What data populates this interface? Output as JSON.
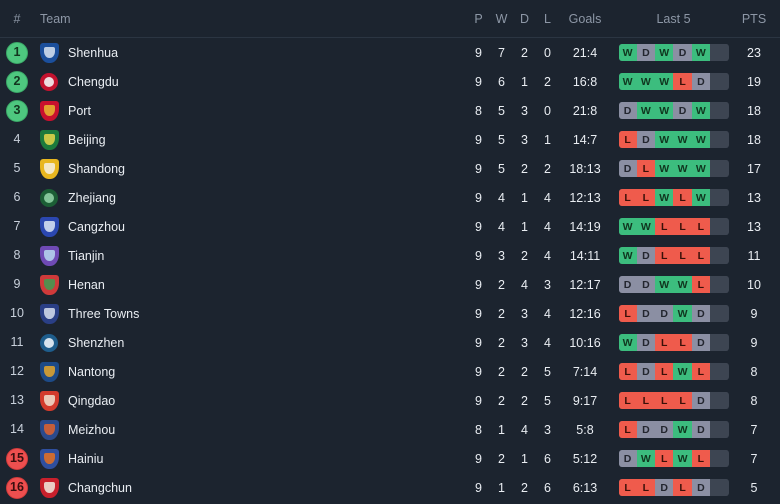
{
  "header": {
    "rank": "#",
    "team": "Team",
    "played": "P",
    "won": "W",
    "drawn": "D",
    "lost": "L",
    "goals": "Goals",
    "last5": "Last 5",
    "points": "PTS"
  },
  "colors": {
    "background": "#1c242f",
    "promotion_badge": "#4ec77f",
    "relegation_badge": "#ee4f4f",
    "win": "#3cbd7e",
    "draw": "#8b8fa3",
    "loss": "#ef5b4c",
    "empty_slot": "#3d4552",
    "text": "#e9edf2",
    "muted_text": "#8d97a6",
    "divider": "#2b3542"
  },
  "rows": [
    {
      "rank": "1",
      "team": "Shenhua",
      "p": "9",
      "w": "7",
      "d": "2",
      "l": "0",
      "goals": "21:4",
      "last5": [
        "W",
        "D",
        "W",
        "D",
        "W"
      ],
      "pts": "23",
      "zone": "promo",
      "crest": {
        "shape": "shield",
        "primary": "#1b4f9c",
        "secondary": "#d9e4f2"
      }
    },
    {
      "rank": "2",
      "team": "Chengdu",
      "p": "9",
      "w": "6",
      "d": "1",
      "l": "2",
      "goals": "16:8",
      "last5": [
        "W",
        "W",
        "W",
        "L",
        "D"
      ],
      "pts": "19",
      "zone": "promo",
      "crest": {
        "shape": "circle",
        "primary": "#c3122e",
        "secondary": "#f2f2f2"
      }
    },
    {
      "rank": "3",
      "team": "Port",
      "p": "8",
      "w": "5",
      "d": "3",
      "l": "0",
      "goals": "21:8",
      "last5": [
        "D",
        "W",
        "W",
        "D",
        "W"
      ],
      "pts": "18",
      "zone": "promo",
      "crest": {
        "shape": "shield",
        "primary": "#c8102e",
        "secondary": "#e8b92f"
      }
    },
    {
      "rank": "4",
      "team": "Beijing",
      "p": "9",
      "w": "5",
      "d": "3",
      "l": "1",
      "goals": "14:7",
      "last5": [
        "L",
        "D",
        "W",
        "W",
        "W"
      ],
      "pts": "18",
      "zone": "none",
      "crest": {
        "shape": "shield",
        "primary": "#1c7a3c",
        "secondary": "#e8d74a"
      }
    },
    {
      "rank": "5",
      "team": "Shandong",
      "p": "9",
      "w": "5",
      "d": "2",
      "l": "2",
      "goals": "18:13",
      "last5": [
        "D",
        "L",
        "W",
        "W",
        "W"
      ],
      "pts": "17",
      "zone": "none",
      "crest": {
        "shape": "shield",
        "primary": "#e8b61f",
        "secondary": "#f4f0e4"
      }
    },
    {
      "rank": "6",
      "team": "Zhejiang",
      "p": "9",
      "w": "4",
      "d": "1",
      "l": "4",
      "goals": "12:13",
      "last5": [
        "L",
        "L",
        "W",
        "L",
        "W"
      ],
      "pts": "13",
      "zone": "none",
      "crest": {
        "shape": "circle",
        "primary": "#1b5e35",
        "secondary": "#8fd0a4"
      }
    },
    {
      "rank": "7",
      "team": "Cangzhou",
      "p": "9",
      "w": "4",
      "d": "1",
      "l": "4",
      "goals": "14:19",
      "last5": [
        "W",
        "W",
        "L",
        "L",
        "L"
      ],
      "pts": "13",
      "zone": "none",
      "crest": {
        "shape": "shield",
        "primary": "#2b47b0",
        "secondary": "#dde6f5"
      }
    },
    {
      "rank": "8",
      "team": "Tianjin",
      "p": "9",
      "w": "3",
      "d": "2",
      "l": "4",
      "goals": "14:11",
      "last5": [
        "W",
        "D",
        "L",
        "L",
        "L"
      ],
      "pts": "11",
      "zone": "none",
      "crest": {
        "shape": "shield",
        "primary": "#6f4ab5",
        "secondary": "#b9d8f0"
      }
    },
    {
      "rank": "9",
      "team": "Henan",
      "p": "9",
      "w": "2",
      "d": "4",
      "l": "3",
      "goals": "12:17",
      "last5": [
        "D",
        "D",
        "W",
        "W",
        "L"
      ],
      "pts": "10",
      "zone": "none",
      "crest": {
        "shape": "shield",
        "primary": "#cf3a3a",
        "secondary": "#3f9e52"
      }
    },
    {
      "rank": "10",
      "team": "Three Towns",
      "p": "9",
      "w": "2",
      "d": "3",
      "l": "4",
      "goals": "12:16",
      "last5": [
        "L",
        "D",
        "D",
        "W",
        "D"
      ],
      "pts": "9",
      "zone": "none",
      "crest": {
        "shape": "shield",
        "primary": "#2a3f86",
        "secondary": "#d7dfee"
      }
    },
    {
      "rank": "11",
      "team": "Shenzhen",
      "p": "9",
      "w": "2",
      "d": "3",
      "l": "4",
      "goals": "10:16",
      "last5": [
        "W",
        "D",
        "L",
        "L",
        "D"
      ],
      "pts": "9",
      "zone": "none",
      "crest": {
        "shape": "circle",
        "primary": "#1e5d8c",
        "secondary": "#eaf2f8"
      }
    },
    {
      "rank": "12",
      "team": "Nantong",
      "p": "9",
      "w": "2",
      "d": "2",
      "l": "5",
      "goals": "7:14",
      "last5": [
        "L",
        "D",
        "L",
        "W",
        "L"
      ],
      "pts": "8",
      "zone": "none",
      "crest": {
        "shape": "shield",
        "primary": "#1d4a87",
        "secondary": "#e5a62a"
      }
    },
    {
      "rank": "13",
      "team": "Qingdao",
      "p": "9",
      "w": "2",
      "d": "2",
      "l": "5",
      "goals": "9:17",
      "last5": [
        "L",
        "L",
        "L",
        "L",
        "D"
      ],
      "pts": "8",
      "zone": "none",
      "crest": {
        "shape": "shield",
        "primary": "#d23b2c",
        "secondary": "#f0e3d0"
      }
    },
    {
      "rank": "14",
      "team": "Meizhou",
      "p": "8",
      "w": "1",
      "d": "4",
      "l": "3",
      "goals": "5:8",
      "last5": [
        "L",
        "D",
        "D",
        "W",
        "D"
      ],
      "pts": "7",
      "zone": "none",
      "crest": {
        "shape": "shield",
        "primary": "#2b4a8c",
        "secondary": "#e2622c"
      }
    },
    {
      "rank": "15",
      "team": "Hainiu",
      "p": "9",
      "w": "2",
      "d": "1",
      "l": "6",
      "goals": "5:12",
      "last5": [
        "D",
        "W",
        "L",
        "W",
        "L"
      ],
      "pts": "7",
      "zone": "releg",
      "crest": {
        "shape": "shield",
        "primary": "#2f4f9e",
        "secondary": "#e8701f"
      }
    },
    {
      "rank": "16",
      "team": "Changchun",
      "p": "9",
      "w": "1",
      "d": "2",
      "l": "6",
      "goals": "6:13",
      "last5": [
        "L",
        "L",
        "D",
        "L",
        "D"
      ],
      "pts": "5",
      "zone": "releg",
      "crest": {
        "shape": "shield",
        "primary": "#c8202c",
        "secondary": "#f0ece0"
      }
    }
  ]
}
